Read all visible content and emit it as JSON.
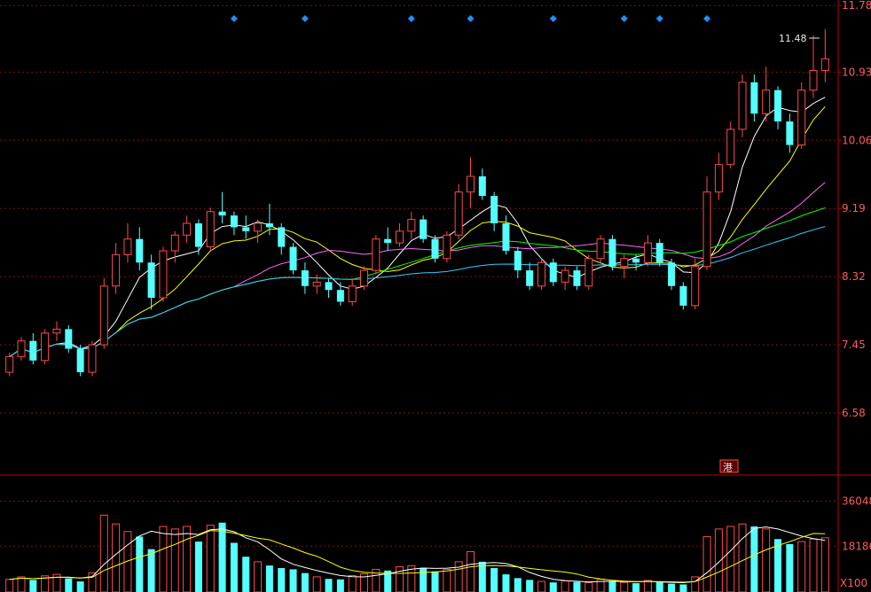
{
  "colors": {
    "background": "#000000",
    "frame": "#c00000",
    "grid": "#7a1515",
    "up": "#ff4a4a",
    "down": "#54ffff",
    "marker": "#1e90ff",
    "ma": [
      "#ffffff",
      "#ffff00",
      "#ff66ff",
      "#00ff00",
      "#33ccff"
    ]
  },
  "annotations": {
    "peak_label": "11.48",
    "bottom_marker": "港",
    "volume_unit": "X100"
  },
  "chart_data": [
    {
      "type": "candlestick",
      "ylim": [
        5.8,
        11.85
      ],
      "yticks": [
        "11.78",
        "10.93",
        "10.06",
        "9.19",
        "8.32",
        "7.45",
        "6.58"
      ],
      "peak": 11.48,
      "ma_lines": 5,
      "signal_markers": 8,
      "grid": true,
      "ohlc": [
        [
          7.1,
          7.35,
          7.05,
          7.3
        ],
        [
          7.3,
          7.55,
          7.25,
          7.5
        ],
        [
          7.5,
          7.6,
          7.2,
          7.25
        ],
        [
          7.25,
          7.65,
          7.2,
          7.6
        ],
        [
          7.6,
          7.75,
          7.5,
          7.65
        ],
        [
          7.65,
          7.7,
          7.35,
          7.4
        ],
        [
          7.4,
          7.45,
          7.05,
          7.1
        ],
        [
          7.1,
          7.5,
          7.05,
          7.45
        ],
        [
          7.45,
          8.3,
          7.4,
          8.2
        ],
        [
          8.2,
          8.75,
          8.1,
          8.6
        ],
        [
          8.6,
          9.0,
          8.5,
          8.8
        ],
        [
          8.8,
          8.95,
          8.4,
          8.5
        ],
        [
          8.5,
          8.6,
          7.9,
          8.05
        ],
        [
          8.05,
          8.7,
          8.0,
          8.65
        ],
        [
          8.65,
          8.9,
          8.5,
          8.85
        ],
        [
          8.85,
          9.1,
          8.75,
          9.0
        ],
        [
          9.0,
          9.05,
          8.6,
          8.7
        ],
        [
          8.7,
          9.2,
          8.65,
          9.15
        ],
        [
          9.15,
          9.4,
          9.0,
          9.1
        ],
        [
          9.1,
          9.15,
          8.85,
          8.95
        ],
        [
          8.95,
          9.1,
          8.8,
          8.9
        ],
        [
          8.9,
          9.05,
          8.75,
          9.0
        ],
        [
          9.0,
          9.25,
          8.85,
          8.95
        ],
        [
          8.95,
          9.0,
          8.6,
          8.7
        ],
        [
          8.7,
          8.75,
          8.35,
          8.4
        ],
        [
          8.4,
          8.5,
          8.1,
          8.2
        ],
        [
          8.2,
          8.35,
          8.1,
          8.25
        ],
        [
          8.25,
          8.3,
          8.05,
          8.15
        ],
        [
          8.15,
          8.25,
          7.95,
          8.0
        ],
        [
          8.0,
          8.3,
          7.95,
          8.2
        ],
        [
          8.2,
          8.45,
          8.15,
          8.4
        ],
        [
          8.4,
          8.85,
          8.35,
          8.8
        ],
        [
          8.8,
          8.95,
          8.65,
          8.75
        ],
        [
          8.75,
          9.0,
          8.7,
          8.9
        ],
        [
          8.9,
          9.15,
          8.8,
          9.05
        ],
        [
          9.05,
          9.1,
          8.75,
          8.8
        ],
        [
          8.8,
          8.85,
          8.5,
          8.55
        ],
        [
          8.55,
          8.9,
          8.5,
          8.85
        ],
        [
          8.85,
          9.5,
          8.8,
          9.4
        ],
        [
          9.4,
          9.85,
          9.2,
          9.6
        ],
        [
          9.6,
          9.7,
          9.3,
          9.35
        ],
        [
          9.35,
          9.4,
          8.9,
          9.0
        ],
        [
          9.0,
          9.1,
          8.6,
          8.65
        ],
        [
          8.65,
          8.7,
          8.3,
          8.4
        ],
        [
          8.4,
          8.5,
          8.15,
          8.2
        ],
        [
          8.2,
          8.55,
          8.15,
          8.5
        ],
        [
          8.5,
          8.55,
          8.2,
          8.25
        ],
        [
          8.25,
          8.45,
          8.15,
          8.4
        ],
        [
          8.4,
          8.45,
          8.15,
          8.2
        ],
        [
          8.2,
          8.6,
          8.15,
          8.55
        ],
        [
          8.55,
          8.85,
          8.5,
          8.8
        ],
        [
          8.8,
          8.85,
          8.4,
          8.45
        ],
        [
          8.45,
          8.6,
          8.3,
          8.55
        ],
        [
          8.55,
          8.6,
          8.4,
          8.5
        ],
        [
          8.5,
          8.85,
          8.45,
          8.75
        ],
        [
          8.75,
          8.8,
          8.45,
          8.5
        ],
        [
          8.5,
          8.55,
          8.15,
          8.2
        ],
        [
          8.2,
          8.25,
          7.9,
          7.95
        ],
        [
          7.95,
          8.55,
          7.9,
          8.45
        ],
        [
          8.45,
          9.6,
          8.4,
          9.4
        ],
        [
          9.4,
          9.9,
          9.3,
          9.75
        ],
        [
          9.75,
          10.3,
          9.7,
          10.2
        ],
        [
          10.2,
          10.9,
          10.1,
          10.8
        ],
        [
          10.8,
          10.9,
          10.3,
          10.4
        ],
        [
          10.4,
          11.0,
          10.3,
          10.7
        ],
        [
          10.7,
          10.75,
          10.2,
          10.3
        ],
        [
          10.3,
          10.4,
          9.9,
          10.0
        ],
        [
          10.0,
          10.8,
          9.95,
          10.7
        ],
        [
          10.7,
          11.4,
          10.6,
          10.95
        ],
        [
          10.95,
          11.48,
          10.8,
          11.1
        ]
      ]
    },
    {
      "type": "bar",
      "ylim": [
        0,
        45000
      ],
      "yticks": [
        "36048",
        "18186"
      ],
      "unit": "X100",
      "values": [
        5000,
        6000,
        4800,
        6400,
        7000,
        5400,
        4200,
        7600,
        30500,
        27000,
        24000,
        22000,
        17000,
        26000,
        25000,
        26000,
        20000,
        26500,
        27500,
        19500,
        14000,
        12000,
        10500,
        9500,
        9000,
        7500,
        6000,
        5200,
        5000,
        6500,
        7200,
        9000,
        8500,
        10000,
        10400,
        9600,
        8200,
        9000,
        12000,
        16000,
        12000,
        9500,
        7000,
        5500,
        4800,
        4200,
        3800,
        4400,
        4000,
        3700,
        5000,
        4200,
        3800,
        3500,
        4600,
        4000,
        3300,
        3000,
        6000,
        22000,
        25000,
        26000,
        27000,
        26000,
        25000,
        21000,
        19000,
        20000,
        21000,
        21500
      ]
    }
  ]
}
